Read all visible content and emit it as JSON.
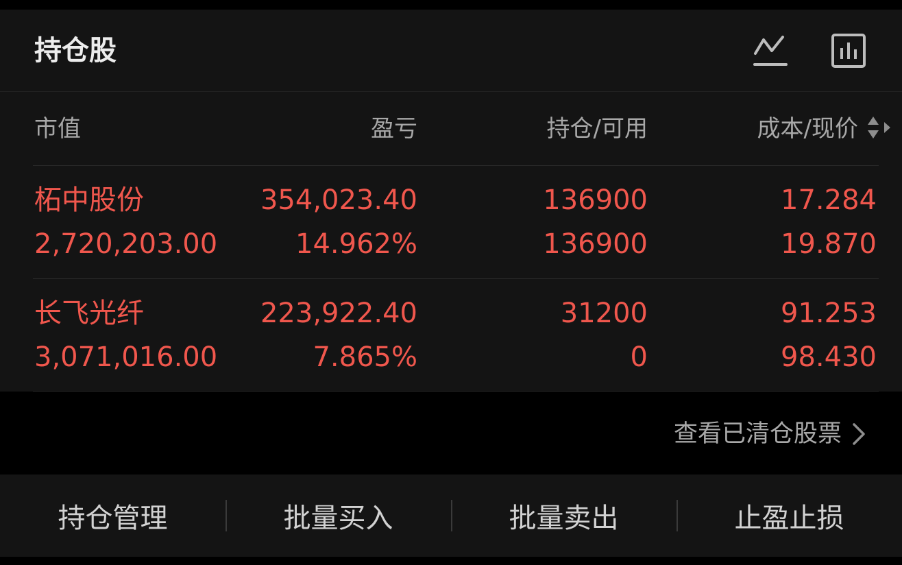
{
  "header": {
    "title": "持仓股",
    "icons": [
      "trend-line-icon",
      "bar-chart-icon"
    ]
  },
  "columns": {
    "market_value": "市值",
    "profit_loss": "盈亏",
    "position_available": "持仓/可用",
    "cost_price": "成本/现价"
  },
  "holdings": [
    {
      "name": "柘中股份",
      "market_value": "2,720,203.00",
      "profit_loss": "354,023.40",
      "profit_loss_pct": "14.962%",
      "position": "136900",
      "available": "136900",
      "cost": "17.284",
      "price": "19.870"
    },
    {
      "name": "长飞光纤",
      "market_value": "3,071,016.00",
      "profit_loss": "223,922.40",
      "profit_loss_pct": "7.865%",
      "position": "31200",
      "available": "0",
      "cost": "91.253",
      "price": "98.430"
    }
  ],
  "cleared_link": "查看已清仓股票",
  "actions": {
    "manage": "持仓管理",
    "batch_buy": "批量买入",
    "batch_sell": "批量卖出",
    "stop": "止盈止损"
  },
  "colors": {
    "gain": "#F0574D",
    "card_bg": "#141414",
    "page_bg": "#000000"
  }
}
